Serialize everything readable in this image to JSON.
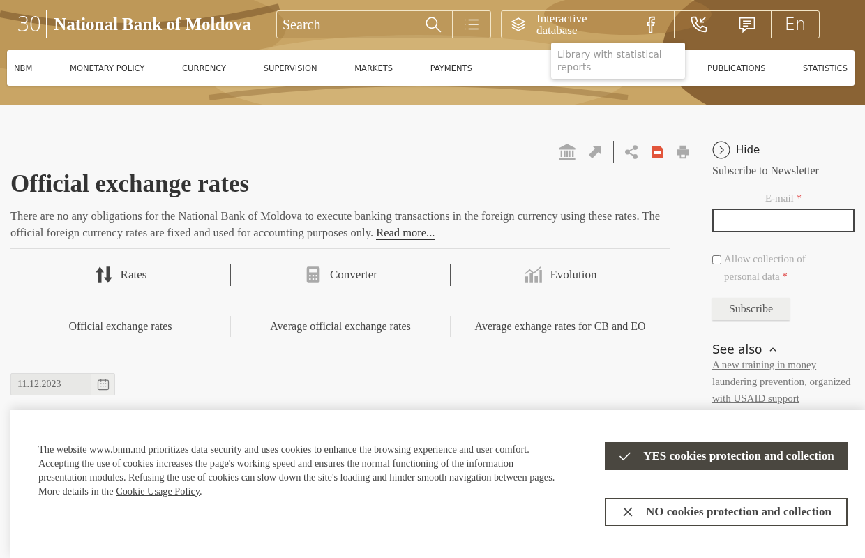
{
  "header": {
    "logo_number": "30",
    "site_title": "National Bank of Moldova",
    "search": {
      "placeholder": "Search"
    },
    "database_link": "Interactive database",
    "language": "En"
  },
  "tooltip": "Library with statistical reports",
  "nav": [
    "NBM",
    "MONETARY POLICY",
    "CURRENCY",
    "SUPERVISION",
    "MARKETS",
    "PAYMENTS",
    "PUBLICATIONS",
    "STATISTICS"
  ],
  "page": {
    "title": "Official exchange rates",
    "intro": "There are no any obligations for the National Bank of Moldova to execute banking transactions in the foreign currency using these rates. The official foreign currency rates are fixed and used for accounting purposes only.",
    "read_more": "Read more...",
    "tabs": [
      {
        "label": "Rates",
        "kind": "rates",
        "selected": true
      },
      {
        "label": "Converter",
        "kind": "converter",
        "selected": false
      },
      {
        "label": "Evolution",
        "kind": "evolution",
        "selected": false
      }
    ],
    "subtabs": [
      "Official exchange rates",
      "Average official exchange rates",
      "Average exhange rates for CB and EO"
    ],
    "date": "11.12.2023"
  },
  "sidebar": {
    "hide": "Hide",
    "newsletter_title": "Subscribe to Newsletter",
    "email_label": "E-mail",
    "required_mark": "*",
    "consent": {
      "label": "Allow collection of personal data",
      "checked": false
    },
    "subscribe": "Subscribe",
    "see_also": {
      "title": "See also",
      "expanded": true,
      "link": "A new training in money laundering prevention, organized with USAID support"
    }
  },
  "cookie_banner": {
    "text": "The website www.bnm.md prioritizes data security and uses cookies to enhance the browsing experience and user comfort. Accepting the use of cookies increases the page's working speed and ensures the normal functioning of the information presentation modules. Refusing the use of cookies can slow down the site's loading and hinder smooth navigation between pages. More details in the",
    "link": "Cookie Usage Policy",
    "end": ".",
    "accept": "YES cookies protection and collection",
    "reject": "NO cookies protection and collection"
  }
}
